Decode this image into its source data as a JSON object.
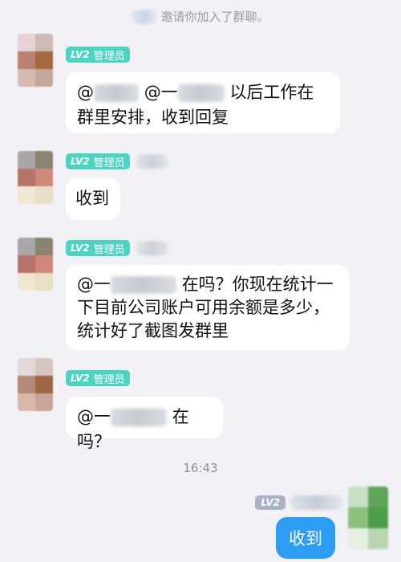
{
  "system_notice": "邀请你加入了群聊。",
  "badge": {
    "level": "LV2",
    "role": "管理员"
  },
  "messages": [
    {
      "mention": "@",
      "mention2": "@一",
      "text": "以后工作在群里安排，收到回复"
    },
    {
      "text": "收到"
    },
    {
      "mention": "@一",
      "text": "在吗？你现在统计一下目前公司账户可用余额是多少，统计好了截图发群里"
    },
    {
      "mention": "@一",
      "text": "在吗？"
    }
  ],
  "timestamp": "16:43",
  "self": {
    "level": "LV2",
    "reply": "收到"
  },
  "colors": {
    "admin_badge": "#4cd3c2",
    "self_bubble": "#2d9cf3",
    "self_badge": "#a9b2c6",
    "background": "#f2f2f6"
  }
}
